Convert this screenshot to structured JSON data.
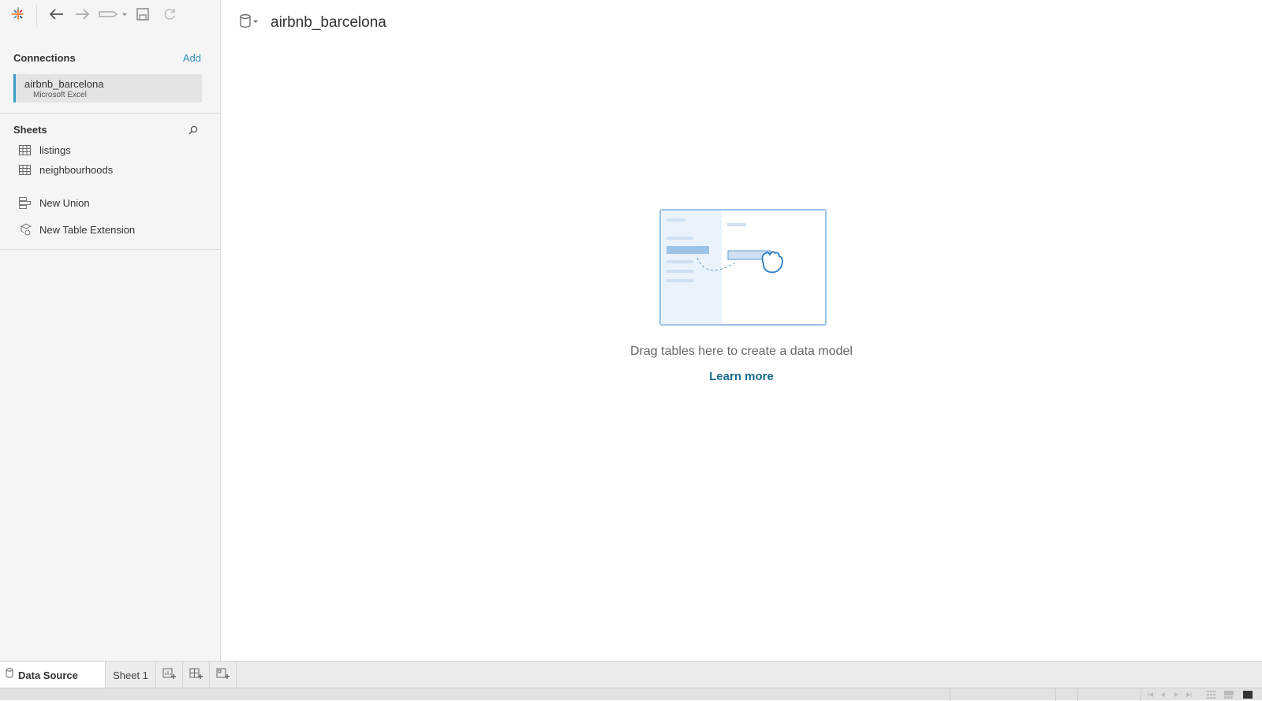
{
  "toolbar": {
    "icons": [
      "tableau-logo-icon",
      "back-arrow-icon",
      "forward-arrow-icon",
      "redo-dropdown-icon",
      "save-icon",
      "refresh-icon"
    ]
  },
  "connections": {
    "title": "Connections",
    "add_label": "Add",
    "items": [
      {
        "name": "airbnb_barcelona",
        "type": "Microsoft Excel"
      }
    ]
  },
  "sheets": {
    "title": "Sheets",
    "items": [
      {
        "label": "listings",
        "icon": "table-icon"
      },
      {
        "label": "neighbourhoods",
        "icon": "table-icon"
      }
    ],
    "actions": [
      {
        "label": "New Union",
        "icon": "union-icon"
      },
      {
        "label": "New Table Extension",
        "icon": "table-extension-icon"
      }
    ]
  },
  "main": {
    "datasource_title": "airbnb_barcelona",
    "empty_message": "Drag tables here to create a data model",
    "learn_more": "Learn more"
  },
  "tabs": {
    "data_source": "Data Source",
    "sheets": [
      "Sheet 1"
    ]
  },
  "colors": {
    "accent": "#3d9dc7",
    "link": "#2e8fb6",
    "learn_more": "#1b6a8d",
    "illustration": "#5b9bd5"
  }
}
